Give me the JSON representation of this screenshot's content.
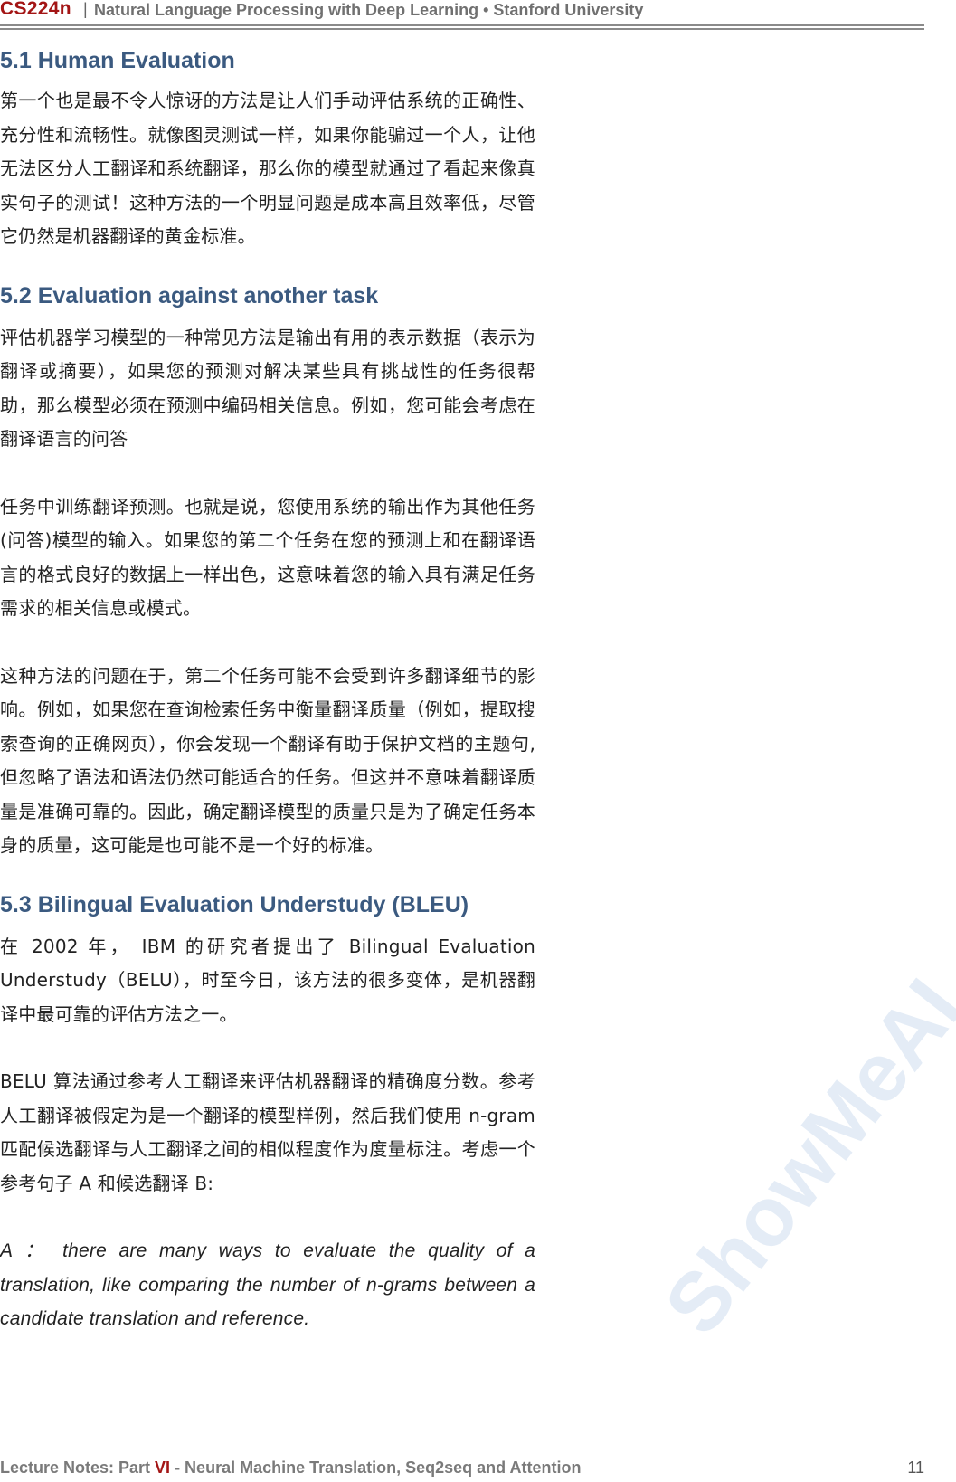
{
  "header": {
    "brand": "CS224n",
    "separator": "|",
    "title": "Natural Language Processing with Deep Learning • Stanford University"
  },
  "sections": [
    {
      "title": "5.1 Human Evaluation",
      "paragraphs": [
        "第一个也是最不令人惊讶的方法是让人们手动评估系统的正确性、充分性和流畅性。就像图灵测试一样，如果你能骗过一个人，让他无法区分人工翻译和系统翻译，那么你的模型就通过了看起来像真实句子的测试！这种方法的一个明显问题是成本高且效率低，尽管它仍然是机器翻译的黄金标准。"
      ]
    },
    {
      "title": "5.2 Evaluation against another task",
      "paragraphs": [
        "评估机器学习模型的一种常见方法是输出有用的表示数据（表示为翻译或摘要），如果您的预测对解决某些具有挑战性的任务很帮助，那么模型必须在预测中编码相关信息。例如，您可能会考虑在翻译语言的问答",
        "任务中训练翻译预测。也就是说，您使用系统的输出作为其他任务(问答)模型的输入。如果您的第二个任务在您的预测上和在翻译语言的格式良好的数据上一样出色，这意味着您的输入具有满足任务需求的相关信息或模式。",
        "这种方法的问题在于，第二个任务可能不会受到许多翻译细节的影响。例如，如果您在查询检索任务中衡量翻译质量（例如，提取搜索查询的正确网页），你会发现一个翻译有助于保护文档的主题句,但忽略了语法和语法仍然可能适合的任务。但这并不意味着翻译质量是准确可靠的。因此，确定翻译模型的质量只是为了确定任务本身的质量，这可能是也可能不是一个好的标准。"
      ]
    },
    {
      "title": "5.3 Bilingual Evaluation Understudy (BLEU)",
      "paragraphs": [
        "在 2002 年， IBM 的研究者提出了 Bilingual Evaluation Understudy（BELU），时至今日，该方法的很多变体，是机器翻译中最可靠的评估方法之一。",
        "BELU 算法通过参考人工翻译来评估机器翻译的精确度分数。参考人工翻译被假定为是一个翻译的模型样例，然后我们使用 n-gram 匹配候选翻译与人工翻译之间的相似程度作为度量标注。考虑一个参考句子 A 和候选翻译 B:",
        "A ： there are many ways to evaluate the quality of a translation, like comparing the number of n-grams between a candidate translation and reference."
      ]
    }
  ],
  "footer": {
    "prefix": "Lecture Notes: Part ",
    "part": "VI",
    "suffix": " - Neural Machine Translation, Seq2seq and Attention",
    "page": "11"
  },
  "watermark": "ShowMeAI"
}
